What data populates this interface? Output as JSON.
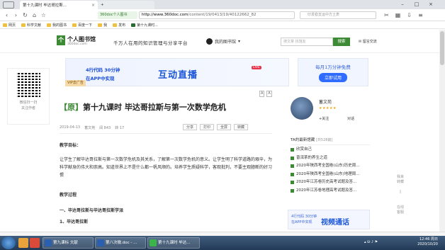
{
  "browser": {
    "tabs": [
      {
        "label": "第十九课时 毕达哥拉斯..."
      },
      {
        "label": ""
      }
    ],
    "site_pill": "360doc个人图书",
    "url_domain": "http://www.360doc.com",
    "url_path": "/content/19/0413/19/40122662_82",
    "search_placeholder": "印发稳支运中方土表",
    "bookmarks": [
      "网页",
      "科学文献",
      "我的图书",
      "百度一下",
      "我",
      "发布",
      "第十九课时..."
    ]
  },
  "site": {
    "logo_char": "个",
    "logo_text": "个人图书馆",
    "logo_sub": "360doc.com",
    "slogan": "千万人在用的知识管理与分享平台",
    "my_library": "我的图书馆",
    "search_placeholder": "搜文章 找馆友",
    "search_button": "搜索",
    "messages": "留言交流"
  },
  "qr": {
    "line1": "微信扫一扫",
    "line2": "关注作者"
  },
  "ad": {
    "line1": "4行代码  30分钟",
    "line2": "在APP中实现",
    "headline": "互动直播",
    "live_tag": "LIVE",
    "vip": "VIP去广告",
    "side_text": "每月1万分钟免费",
    "side_button": "立即试用"
  },
  "article": {
    "font_sizes": [
      "A",
      "A"
    ],
    "tag": "【原】",
    "title": "第十九课时  毕达哥拉斯与第一次数学危机",
    "date": "2019-04-13",
    "author": "蓄文苑",
    "reads": "阅 843",
    "saves": "转 17",
    "actions": [
      "分享",
      "打印",
      "全屏",
      "转藏"
    ],
    "section1_heading": "教学目标：",
    "section1_body": "让学生了解毕达哥拉斯与第一次数学危机及其关系，了解第一次数学危机的意义。让学生明了科学道路的艰辛，为科学献身的伟大和崇高。知道世界上不是什么都一帆风顺的。培养学生质疑科学，客观批判，不要主观臆断的好习惯",
    "section2_heading": "教学过程",
    "item1": "一、毕达哥拉斯与毕达哥拉斯学派",
    "item2": "1、毕达哥拉斯"
  },
  "sidebar": {
    "author_name": "蓄文苑",
    "stars": "★★★★★",
    "follow": "+关注",
    "chat": "对话",
    "related_title": "TA的最新馆藏",
    "related_count": "[共528篇]",
    "related": [
      "欣赏自己",
      "普洱茶的养生之道",
      "2020年陕西考全国卷(山东)历史周...",
      "2020年陕西考全国卷(山东)地理周...",
      "2020年江苏卷历史高考试题及答...",
      "2020年江苏卷地理高考试题及答..."
    ],
    "ad_small": "4行代码  30分钟\n在APP中实现",
    "ad_big": "视频通话"
  },
  "rail": {
    "r1": "我来\n转藏",
    "r2": "",
    "r3": "在线\n客服"
  },
  "taskbar": {
    "items": [
      "第九课标 文献",
      "第八次微.doc - ...",
      "第十九课时 毕达..."
    ],
    "time": "12:46 周日",
    "date": "2020/10/20"
  },
  "colors": {
    "brand_green": "#3d8a35",
    "ad_blue": "#1a56d6",
    "taskbar": "#2c4868"
  }
}
